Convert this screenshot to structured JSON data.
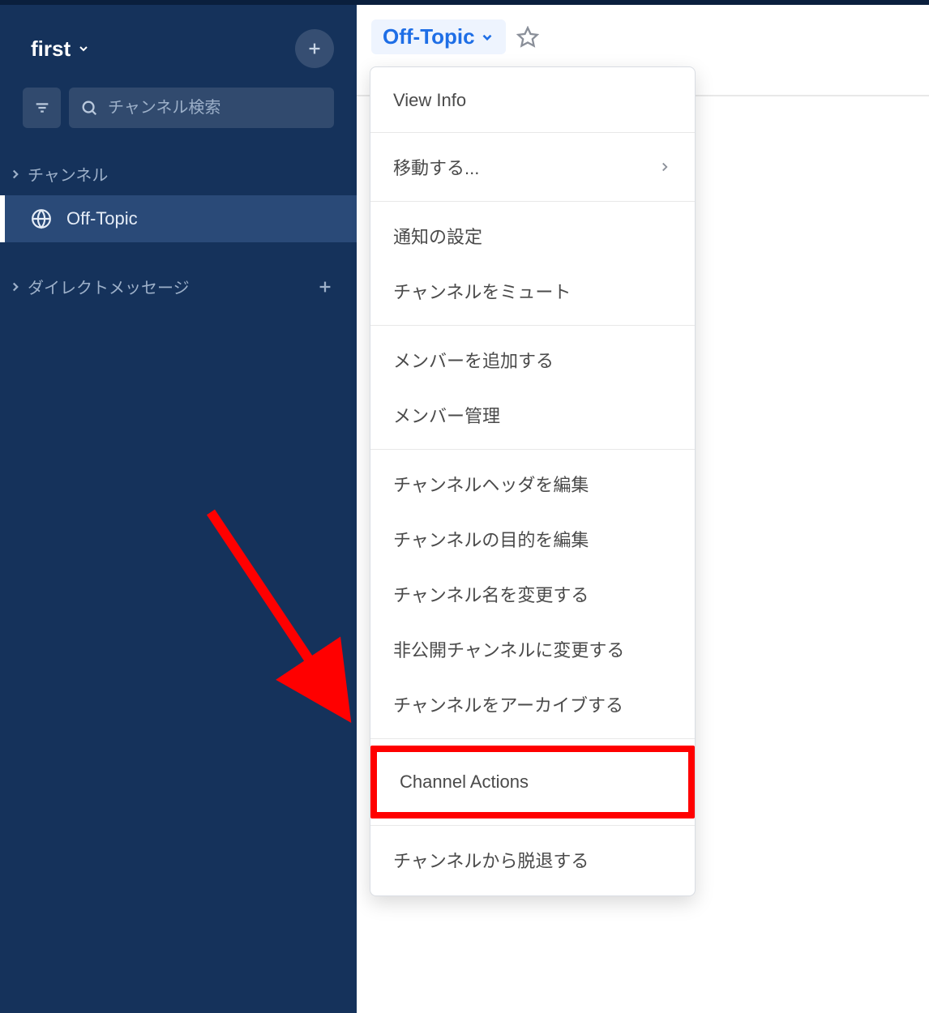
{
  "workspace": {
    "name": "first"
  },
  "search": {
    "placeholder": "チャンネル検索"
  },
  "sidebar": {
    "sections": [
      {
        "label": "チャンネル",
        "items": [
          {
            "label": "Off-Topic",
            "active": true
          }
        ]
      },
      {
        "label": "ダイレクトメッセージ",
        "items": []
      }
    ]
  },
  "channel_header": {
    "title": "Off-Topic"
  },
  "dropdown": {
    "groups": [
      [
        {
          "id": "view-info",
          "label": "View Info",
          "has_chevron": false
        }
      ],
      [
        {
          "id": "move-to",
          "label": "移動する...",
          "has_chevron": true
        }
      ],
      [
        {
          "id": "notification-settings",
          "label": "通知の設定",
          "has_chevron": false
        },
        {
          "id": "mute-channel",
          "label": "チャンネルをミュート",
          "has_chevron": false
        }
      ],
      [
        {
          "id": "add-members",
          "label": "メンバーを追加する",
          "has_chevron": false
        },
        {
          "id": "manage-members",
          "label": "メンバー管理",
          "has_chevron": false
        }
      ],
      [
        {
          "id": "edit-header",
          "label": "チャンネルヘッダを編集",
          "has_chevron": false
        },
        {
          "id": "edit-purpose",
          "label": "チャンネルの目的を編集",
          "has_chevron": false
        },
        {
          "id": "rename-channel",
          "label": "チャンネル名を変更する",
          "has_chevron": false
        },
        {
          "id": "make-private",
          "label": "非公開チャンネルに変更する",
          "has_chevron": false
        },
        {
          "id": "archive-channel",
          "label": "チャンネルをアーカイブする",
          "has_chevron": false
        }
      ],
      [
        {
          "id": "channel-actions",
          "label": "Channel Actions",
          "has_chevron": false,
          "highlighted": true
        }
      ],
      [
        {
          "id": "leave-channel",
          "label": "チャンネルから脱退する",
          "has_chevron": false
        }
      ]
    ]
  },
  "colors": {
    "sidebar_bg": "#15325b",
    "active_bg": "#2a4a78",
    "accent": "#1e6ee6",
    "highlight": "#ff0000"
  }
}
